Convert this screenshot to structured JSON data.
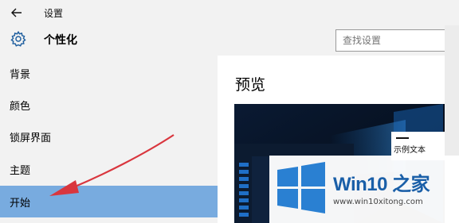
{
  "window": {
    "title": "设置"
  },
  "header": {
    "page_title": "个性化",
    "search_placeholder": "查找设置"
  },
  "sidebar": {
    "items": [
      {
        "label": "背景",
        "active": false
      },
      {
        "label": "颜色",
        "active": false
      },
      {
        "label": "锁屏界面",
        "active": false
      },
      {
        "label": "主题",
        "active": false
      },
      {
        "label": "开始",
        "active": true
      }
    ]
  },
  "content": {
    "heading": "预览",
    "sample_text": "示例文本"
  },
  "watermark": {
    "brand": "Win10 之家",
    "url": "www.win10xitong.com"
  },
  "colors": {
    "accent": "#78abdf",
    "sidebar_bg": "#f2f2f2",
    "annotation_arrow": "#d9363e",
    "watermark_blue": "#1a5fa8"
  },
  "icons": [
    "back-arrow-icon",
    "gear-icon",
    "windows-logo-icon"
  ]
}
